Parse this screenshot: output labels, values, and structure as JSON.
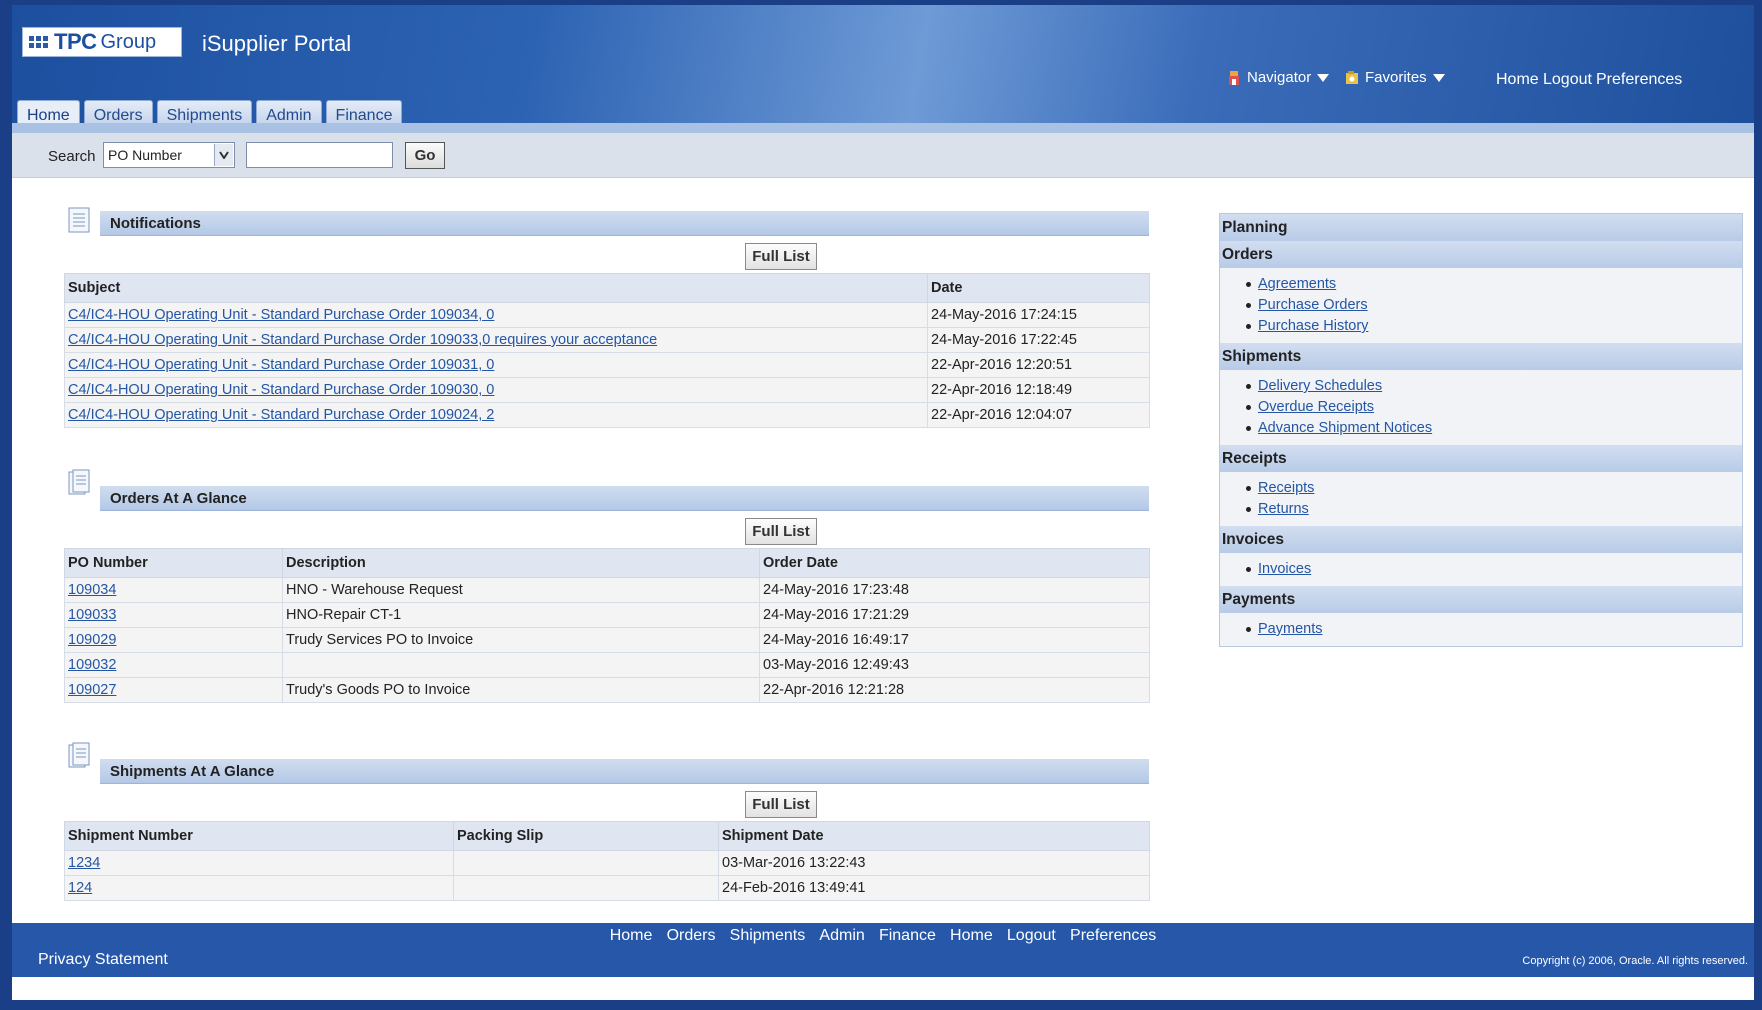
{
  "header": {
    "logo_main": "TPC",
    "logo_sub": "Group",
    "portal_title": "iSupplier Portal",
    "navigator_label": "Navigator",
    "favorites_label": "Favorites",
    "global_links": [
      "Home",
      "Logout",
      "Preferences"
    ]
  },
  "tabs": [
    "Home",
    "Orders",
    "Shipments",
    "Admin",
    "Finance"
  ],
  "search": {
    "label": "Search",
    "selected": "PO Number",
    "value": "",
    "go_label": "Go"
  },
  "notifications": {
    "title": "Notifications",
    "full_list_label": "Full List",
    "columns": [
      "Subject",
      "Date"
    ],
    "rows": [
      {
        "subject": "C4/IC4-HOU Operating Unit - Standard Purchase Order 109034, 0",
        "date": "24-May-2016 17:24:15"
      },
      {
        "subject": "C4/IC4-HOU Operating Unit - Standard Purchase Order 109033,0 requires your acceptance",
        "date": "24-May-2016 17:22:45"
      },
      {
        "subject": "C4/IC4-HOU Operating Unit - Standard Purchase Order 109031, 0",
        "date": "22-Apr-2016 12:20:51"
      },
      {
        "subject": "C4/IC4-HOU Operating Unit - Standard Purchase Order 109030, 0",
        "date": "22-Apr-2016 12:18:49"
      },
      {
        "subject": "C4/IC4-HOU Operating Unit - Standard Purchase Order 109024, 2",
        "date": "22-Apr-2016 12:04:07"
      }
    ]
  },
  "orders": {
    "title": "Orders At A Glance",
    "full_list_label": "Full List",
    "columns": [
      "PO Number",
      "Description",
      "Order Date"
    ],
    "rows": [
      {
        "po": "109034",
        "desc": "HNO - Warehouse Request",
        "date": "24-May-2016 17:23:48"
      },
      {
        "po": "109033",
        "desc": "HNO-Repair CT-1",
        "date": "24-May-2016 17:21:29"
      },
      {
        "po": "109029",
        "desc": "Trudy Services PO to Invoice",
        "date": "24-May-2016 16:49:17"
      },
      {
        "po": "109032",
        "desc": "",
        "date": "03-May-2016 12:49:43"
      },
      {
        "po": "109027",
        "desc": "Trudy's Goods PO to Invoice",
        "date": "22-Apr-2016 12:21:28"
      }
    ]
  },
  "shipments": {
    "title": "Shipments At A Glance",
    "full_list_label": "Full List",
    "columns": [
      "Shipment Number",
      "Packing Slip",
      "Shipment Date"
    ],
    "rows": [
      {
        "num": "1234",
        "slip": "",
        "date": "03-Mar-2016 13:22:43"
      },
      {
        "num": "124",
        "slip": "",
        "date": "24-Feb-2016 13:49:41"
      }
    ]
  },
  "side_panel": {
    "title": "Planning",
    "groups": [
      {
        "title": "Orders",
        "items": [
          "Agreements",
          "Purchase Orders",
          "Purchase History"
        ]
      },
      {
        "title": "Shipments",
        "items": [
          "Delivery Schedules",
          "Overdue Receipts",
          "Advance Shipment Notices"
        ]
      },
      {
        "title": "Receipts",
        "items": [
          "Receipts",
          "Returns"
        ]
      },
      {
        "title": "Invoices",
        "items": [
          "Invoices"
        ]
      },
      {
        "title": "Payments",
        "items": [
          "Payments"
        ]
      }
    ]
  },
  "footer": {
    "links": [
      "Home",
      "Orders",
      "Shipments",
      "Admin",
      "Finance",
      "Home",
      "Logout",
      "Preferences"
    ],
    "privacy": "Privacy Statement",
    "copyright": "Copyright (c) 2006, Oracle. All rights reserved."
  }
}
